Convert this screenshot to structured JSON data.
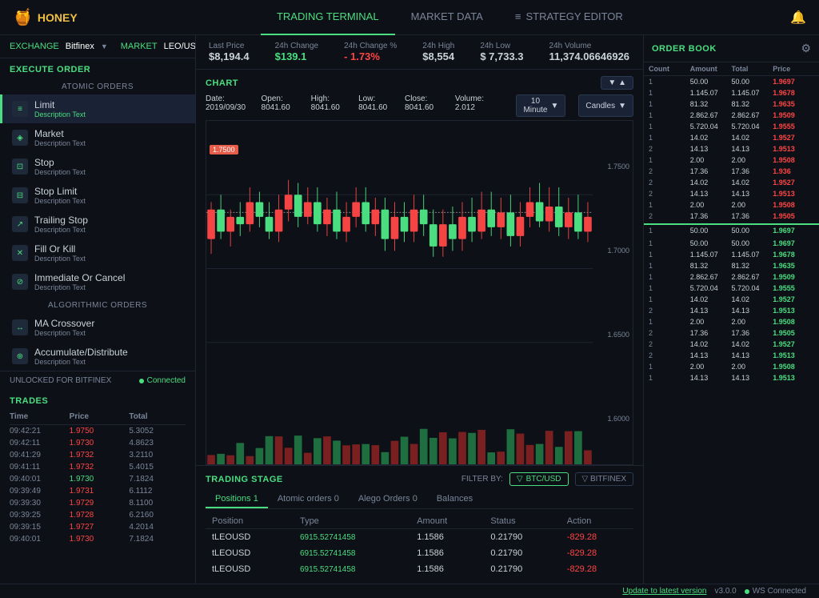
{
  "app": {
    "logo_text": "HONEY",
    "logo_emoji": "🍯"
  },
  "nav": {
    "tabs": [
      {
        "label": "TRADING TERMINAL",
        "active": true
      },
      {
        "label": "MARKET DATA",
        "active": false
      },
      {
        "label": "STRATEGY EDITOR",
        "active": false
      }
    ]
  },
  "exchange_bar": {
    "exchange_label": "EXCHANGE",
    "exchange_value": "Bitfinex",
    "market_label": "MARKET",
    "market_value": "LEO/USD"
  },
  "stats": {
    "last_price_label": "Last Price",
    "last_price_value": "$8,194.4",
    "change_24h_label": "24h Change",
    "change_24h_value": "$139.1",
    "change_pct_label": "24h Change %",
    "change_pct_value": "- 1.73%",
    "high_24h_label": "24h High",
    "high_24h_value": "$8,554",
    "low_24h_label": "24h Low",
    "low_24h_value": "$ 7,733.3",
    "volume_24h_label": "24h Volume",
    "volume_24h_value": "11,374.06646926"
  },
  "chart": {
    "title": "CHART",
    "date_label": "Date:",
    "date_value": "2019/09/30",
    "open_label": "Open:",
    "open_value": "8041.60",
    "high_label": "High:",
    "high_value": "8041.60",
    "low_label": "Low:",
    "low_value": "8041.60",
    "close_label": "Close:",
    "close_value": "8041.60",
    "volume_label": "Volume:",
    "volume_value": "2.012",
    "interval_btn": "10 Minute",
    "candles_btn": "Candles",
    "price_marker": "1.7500",
    "y_labels": [
      "1.7500",
      "1.7000",
      "1.6500",
      "1.6000"
    ],
    "expand_icon": "▼",
    "collapse_icon": "▲"
  },
  "execute_order": {
    "title": "EXECUTE ORDER",
    "atomic_section": "ATOMIC ORDERS",
    "algorithmic_section": "ALGORITHMIC ORDERS",
    "orders": [
      {
        "name": "Limit",
        "desc": "Description Text",
        "active": true
      },
      {
        "name": "Market",
        "desc": "Description Text",
        "active": false
      },
      {
        "name": "Stop",
        "desc": "Description Text",
        "active": false
      },
      {
        "name": "Stop Limit",
        "desc": "Description Text",
        "active": false
      },
      {
        "name": "Trailing Stop",
        "desc": "Description Text",
        "active": false
      },
      {
        "name": "Fill Or Kill",
        "desc": "Description Text",
        "active": false
      },
      {
        "name": "Immediate Or Cancel",
        "desc": "Description Text",
        "active": false
      }
    ],
    "algo_orders": [
      {
        "name": "MA Crossover",
        "desc": "Description Text"
      },
      {
        "name": "Accumulate/Distribute",
        "desc": "Description Text"
      }
    ],
    "unlocked_label": "UNLOCKED FOR BITFINEX",
    "connected_label": "Connected"
  },
  "trades": {
    "title": "TRADES",
    "headers": [
      "Time",
      "Price",
      "Total"
    ],
    "rows": [
      {
        "time": "09:42:21",
        "price": "1.9750",
        "total": "5.3052",
        "price_color": "red"
      },
      {
        "time": "09:42:11",
        "price": "1.9730",
        "total": "4.8623",
        "price_color": "red"
      },
      {
        "time": "09:41:29",
        "price": "1.9732",
        "total": "3.2110",
        "price_color": "red"
      },
      {
        "time": "09:41:11",
        "price": "1.9732",
        "total": "5.4015",
        "price_color": "red"
      },
      {
        "time": "09:40:01",
        "price": "1.9730",
        "total": "7.1824",
        "price_color": "green"
      },
      {
        "time": "09:39:49",
        "price": "1.9731",
        "total": "6.1112",
        "price_color": "red"
      },
      {
        "time": "09:39:30",
        "price": "1.9729",
        "total": "8.1100",
        "price_color": "red"
      },
      {
        "time": "09:39:25",
        "price": "1.9728",
        "total": "6.2160",
        "price_color": "red"
      },
      {
        "time": "09:39:15",
        "price": "1.9727",
        "total": "4.2014",
        "price_color": "red"
      },
      {
        "time": "09:40:01",
        "price": "1.9730",
        "total": "7.1824",
        "price_color": "red"
      }
    ]
  },
  "trading_stage": {
    "title": "TRADING STAGE",
    "filter_label": "FILTER BY:",
    "filter_btc": "BTC/USD",
    "filter_bitfinex": "BITFINEX",
    "tabs": [
      {
        "label": "Positions 1",
        "active": true
      },
      {
        "label": "Atomic orders 0",
        "active": false
      },
      {
        "label": "Alego Orders 0",
        "active": false
      },
      {
        "label": "Balances",
        "active": false
      }
    ],
    "table_headers": [
      "Position",
      "Type",
      "Amount",
      "Status",
      "Action"
    ],
    "rows": [
      {
        "position": "tLEOUSD",
        "type": "6915.52741458",
        "amount": "1.1586",
        "status": "0.21790",
        "action": "-829.28"
      },
      {
        "position": "tLEOUSD",
        "type": "6915.52741458",
        "amount": "1.1586",
        "status": "0.21790",
        "action": "-829.28"
      },
      {
        "position": "tLEOUSD",
        "type": "6915.52741458",
        "amount": "1.1586",
        "status": "0.21790",
        "action": "-829.28"
      }
    ]
  },
  "order_book": {
    "title": "ORDER BOOK",
    "headers": [
      "Count",
      "Amount",
      "Total",
      "Price"
    ],
    "rows_top": [
      {
        "count": "1",
        "amount": "50.00",
        "total": "50.00",
        "price": "1.9697",
        "color": "red"
      },
      {
        "count": "1",
        "amount": "1.145.07",
        "total": "1.145.07",
        "price": "1.9678",
        "color": "red"
      },
      {
        "count": "1",
        "amount": "81.32",
        "total": "81.32",
        "price": "1.9635",
        "color": "red"
      },
      {
        "count": "1",
        "amount": "2.862.67",
        "total": "2.862.67",
        "price": "1.9509",
        "color": "red"
      },
      {
        "count": "1",
        "amount": "5.720.04",
        "total": "5.720.04",
        "price": "1.9555",
        "color": "red"
      },
      {
        "count": "1",
        "amount": "14.02",
        "total": "14.02",
        "price": "1.9527",
        "color": "red"
      },
      {
        "count": "2",
        "amount": "14.13",
        "total": "14.13",
        "price": "1.9513",
        "color": "red"
      },
      {
        "count": "1",
        "amount": "2.00",
        "total": "2.00",
        "price": "1.9508",
        "color": "red"
      },
      {
        "count": "2",
        "amount": "17.36",
        "total": "17.36",
        "price": "1.936",
        "color": "red"
      },
      {
        "count": "2",
        "amount": "14.02",
        "total": "14.02",
        "price": "1.9527",
        "color": "red"
      },
      {
        "count": "2",
        "amount": "14.13",
        "total": "14.13",
        "price": "1.9513",
        "color": "red"
      },
      {
        "count": "1",
        "amount": "2.00",
        "total": "2.00",
        "price": "1.9508",
        "color": "red"
      },
      {
        "count": "2",
        "amount": "17.36",
        "total": "17.36",
        "price": "1.9505",
        "color": "red"
      }
    ],
    "separator_price": {
      "count": "1",
      "amount": "50.00",
      "total": "50.00",
      "price": "1.9697"
    },
    "rows_bottom": [
      {
        "count": "1",
        "amount": "50.00",
        "total": "50.00",
        "price": "1.9697",
        "color": "green"
      },
      {
        "count": "1",
        "amount": "1.145.07",
        "total": "1.145.07",
        "price": "1.9678",
        "color": "green"
      },
      {
        "count": "1",
        "amount": "81.32",
        "total": "81.32",
        "price": "1.9635",
        "color": "green"
      },
      {
        "count": "1",
        "amount": "2.862.67",
        "total": "2.862.67",
        "price": "1.9509",
        "color": "green"
      },
      {
        "count": "1",
        "amount": "5.720.04",
        "total": "5.720.04",
        "price": "1.9555",
        "color": "green"
      },
      {
        "count": "1",
        "amount": "14.02",
        "total": "14.02",
        "price": "1.9527",
        "color": "green"
      },
      {
        "count": "2",
        "amount": "14.13",
        "total": "14.13",
        "price": "1.9513",
        "color": "green"
      },
      {
        "count": "1",
        "amount": "2.00",
        "total": "2.00",
        "price": "1.9508",
        "color": "green"
      },
      {
        "count": "2",
        "amount": "17.36",
        "total": "17.36",
        "price": "1.9505",
        "color": "green"
      },
      {
        "count": "2",
        "amount": "14.02",
        "total": "14.02",
        "price": "1.9527",
        "color": "green"
      },
      {
        "count": "2",
        "amount": "14.13",
        "total": "14.13",
        "price": "1.9513",
        "color": "green"
      },
      {
        "count": "1",
        "amount": "2.00",
        "total": "2.00",
        "price": "1.9508",
        "color": "green"
      },
      {
        "count": "1",
        "amount": "14.13",
        "total": "14.13",
        "price": "1.9513",
        "color": "green"
      }
    ]
  },
  "bottom_bar": {
    "update_label": "Update to latest version",
    "version": "v3.0.0",
    "ws_status": "WS Connected"
  }
}
